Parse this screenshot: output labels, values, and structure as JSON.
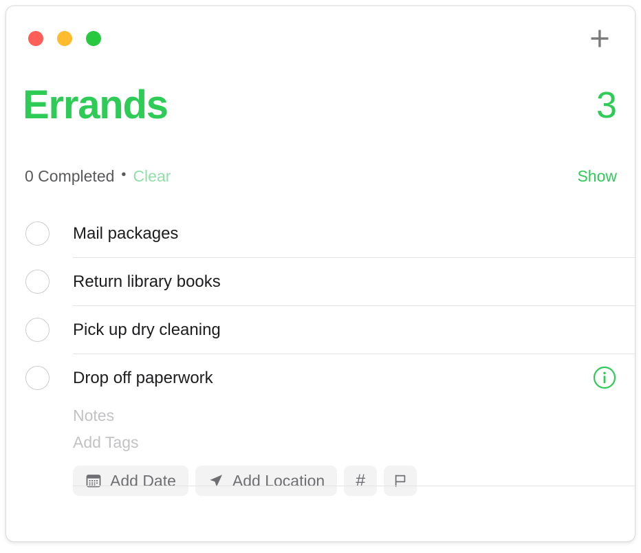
{
  "window": {
    "traffic_lights": [
      {
        "name": "close",
        "color": "#ff5f57"
      },
      {
        "name": "minimize",
        "color": "#febc2e"
      },
      {
        "name": "maximize",
        "color": "#28c840"
      }
    ],
    "add_button_icon": "plus-icon"
  },
  "header": {
    "title": "Errands",
    "count": "3",
    "accent_color": "#2ecc57"
  },
  "subheader": {
    "completed_text": "0 Completed",
    "separator": "•",
    "clear_label": "Clear",
    "clear_color": "#93dfa8",
    "show_label": "Show"
  },
  "tasks": [
    {
      "title": "Mail packages",
      "checked": false,
      "expanded": false
    },
    {
      "title": "Return library books",
      "checked": false,
      "expanded": false
    },
    {
      "title": "Pick up dry cleaning",
      "checked": false,
      "expanded": false
    },
    {
      "title": "Drop off paperwork",
      "checked": false,
      "expanded": true
    }
  ],
  "detail": {
    "notes_placeholder": "Notes",
    "tags_placeholder": "Add Tags",
    "chips": [
      {
        "icon": "calendar-icon",
        "label": "Add Date"
      },
      {
        "icon": "location-arrow-icon",
        "label": "Add Location"
      },
      {
        "icon": "hashtag-icon",
        "label": "#"
      },
      {
        "icon": "flag-icon",
        "label": ""
      }
    ],
    "info_icon": "info-circle-icon"
  }
}
